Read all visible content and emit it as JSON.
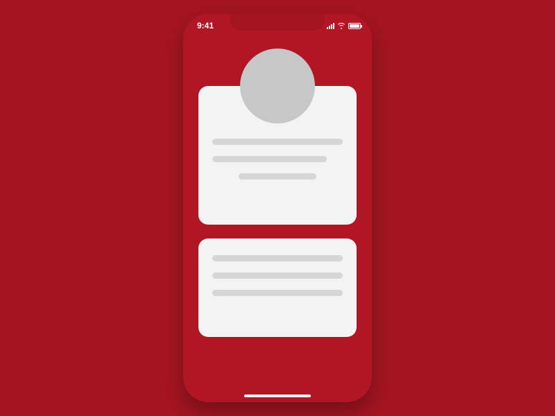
{
  "status_bar": {
    "time": "9:41"
  },
  "theme": {
    "background": "#a31521",
    "phone_bg": "#b01624",
    "card_bg": "#f3f3f3",
    "placeholder": "#d6d6d6",
    "avatar": "#c7c7c7"
  }
}
